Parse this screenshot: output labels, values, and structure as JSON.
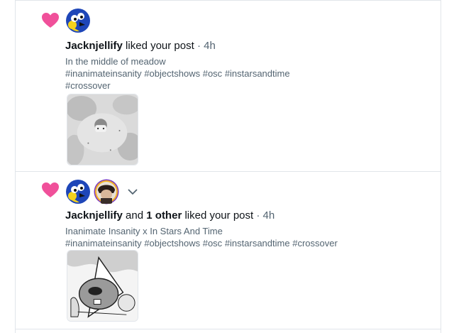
{
  "colors": {
    "heart": "#f0509a",
    "text_secondary": "#536471",
    "divider": "#e1e5ea"
  },
  "notifications": [
    {
      "icon": "heart-icon",
      "user": "Jacknjellify",
      "action": " liked your post",
      "dot": " · ",
      "time": "4h",
      "post_text": "In the middle of meadow",
      "tags": [
        "#inanimateinsanity",
        "#objectshows",
        "#osc",
        "#instarsandtime",
        "#crossover"
      ]
    },
    {
      "icon": "heart-icon",
      "user": "Jacknjellify",
      "connector": " and ",
      "others": "1 other",
      "action": " liked your post",
      "dot": " · ",
      "time": "4h",
      "post_text": "Inanimate Insanity x In Stars And Time",
      "tags": [
        "#inanimateinsanity",
        "#objectshows",
        "#osc",
        "#instarsandtime",
        "#crossover"
      ]
    }
  ]
}
